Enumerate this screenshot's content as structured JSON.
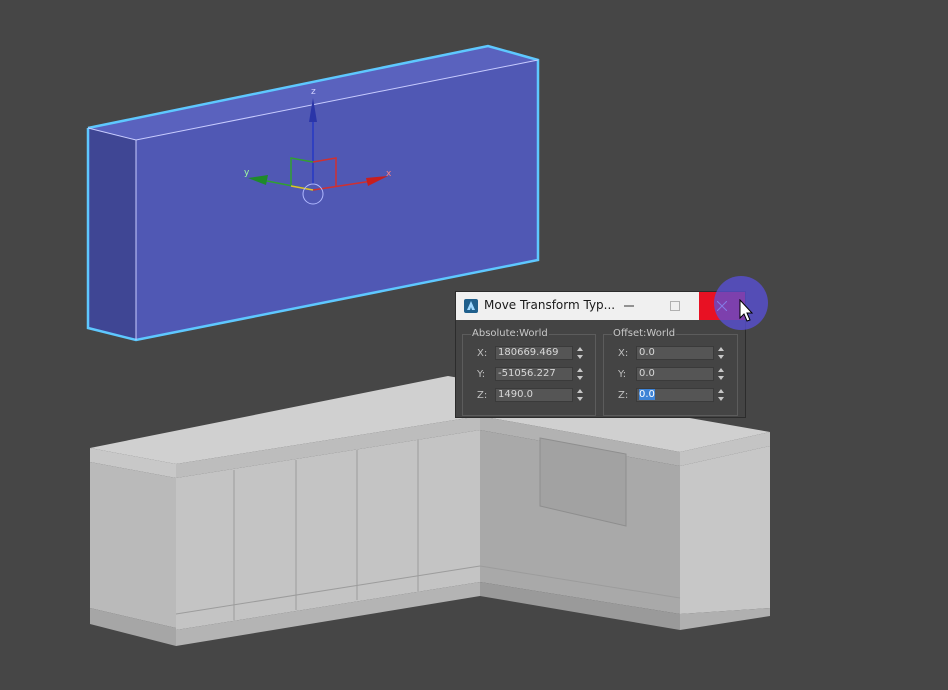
{
  "viewport": {
    "gizmo": {
      "axis_x": "x",
      "axis_y": "y",
      "axis_z": "z"
    },
    "colors": {
      "background": "#464646",
      "selected_box": "#5058b4",
      "selection_outline": "#5ec8ff",
      "cabinet_light": "#c4c4c4",
      "cabinet_shade": "#a8a8a8",
      "cabinet_top": "#d0d0d0"
    }
  },
  "dialog": {
    "title": "Move Transform Typ...",
    "app_icon": "3dsmax-app-icon",
    "absolute": {
      "label": "Absolute:World",
      "x_label": "X:",
      "x_value": "180669.469",
      "y_label": "Y:",
      "y_value": "-51056.227",
      "z_label": "Z:",
      "z_value": "1490.0"
    },
    "offset": {
      "label": "Offset:World",
      "x_label": "X:",
      "x_value": "0.0",
      "y_label": "Y:",
      "y_value": "0.0",
      "z_label": "Z:",
      "z_value": "0.0"
    }
  }
}
